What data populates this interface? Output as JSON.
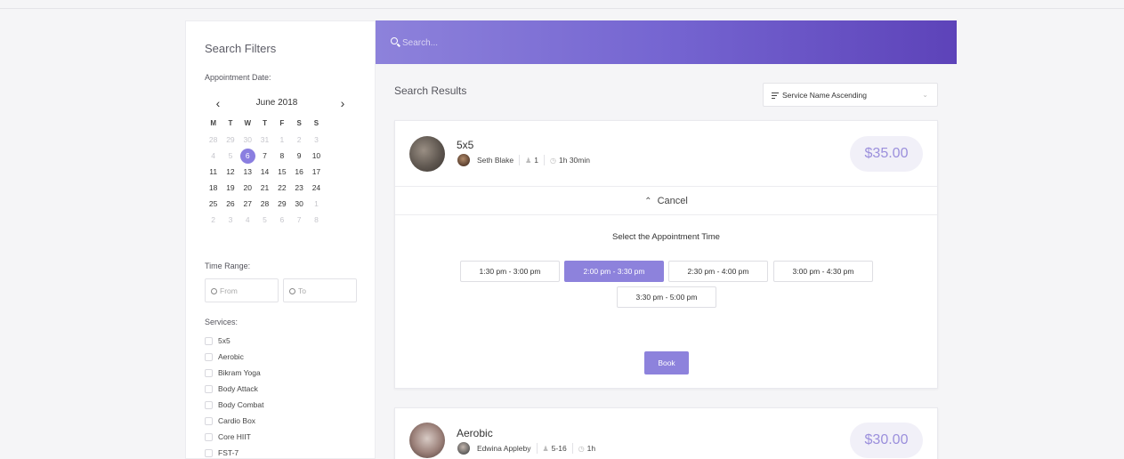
{
  "sidebar": {
    "title": "Search Filters",
    "date_label": "Appointment Date:",
    "calendar": {
      "month": "June 2018",
      "prev": "‹",
      "next": "›",
      "weekdays": [
        "M",
        "T",
        "W",
        "T",
        "F",
        "S",
        "S"
      ],
      "weeks": [
        [
          "28",
          "29",
          "30",
          "31",
          "1",
          "2",
          "3"
        ],
        [
          "4",
          "5",
          "6",
          "7",
          "8",
          "9",
          "10"
        ],
        [
          "11",
          "12",
          "13",
          "14",
          "15",
          "16",
          "17"
        ],
        [
          "18",
          "19",
          "20",
          "21",
          "22",
          "23",
          "24"
        ],
        [
          "25",
          "26",
          "27",
          "28",
          "29",
          "30",
          "1"
        ],
        [
          "2",
          "3",
          "4",
          "5",
          "6",
          "7",
          "8"
        ]
      ],
      "selected": "6"
    },
    "time_label": "Time Range:",
    "time_from": "From",
    "time_to": "To",
    "services_label": "Services:",
    "services": [
      "5x5",
      "Aerobic",
      "Bikram Yoga",
      "Body Attack",
      "Body Combat",
      "Cardio Box",
      "Core HIIT",
      "FST-7"
    ]
  },
  "search": {
    "placeholder": "Search..."
  },
  "results": {
    "title": "Search Results",
    "sort_label": "Service Name Ascending",
    "cards": [
      {
        "service": "5x5",
        "trainer": "Seth Blake",
        "capacity": "1",
        "duration": "1h 30min",
        "price": "$35.00",
        "cancel_label": "Cancel",
        "select_title": "Select the Appointment Time",
        "slots": [
          "1:30 pm - 3:00 pm",
          "2:00 pm - 3:30 pm",
          "2:30 pm - 4:00 pm",
          "3:00 pm - 4:30 pm",
          "3:30 pm - 5:00 pm"
        ],
        "active_slot": "2:00 pm - 3:30 pm",
        "book_label": "Book"
      },
      {
        "service": "Aerobic",
        "trainer": "Edwina Appleby",
        "capacity": "5-16",
        "duration": "1h",
        "price": "$30.00"
      }
    ]
  },
  "colors": {
    "accent": "#8d82dc",
    "gradient_start": "#8d82db",
    "gradient_end": "#5d43b9"
  }
}
